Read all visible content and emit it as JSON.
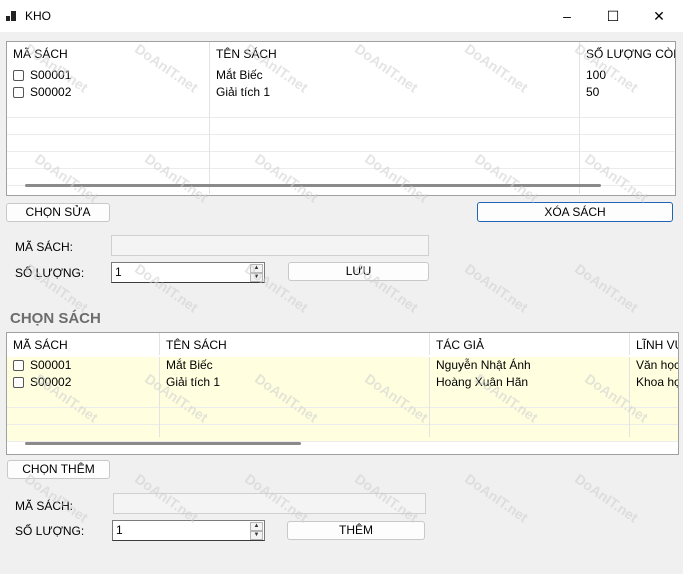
{
  "window": {
    "title": "KHO",
    "minimize_icon": "–",
    "maximize_icon": "☐",
    "close_icon": "✕"
  },
  "grid1": {
    "headers": [
      "MÃ SÁCH",
      "TÊN SÁCH",
      "SỐ LƯỢNG CÒN LẠI"
    ],
    "rows": [
      {
        "ma": "S00001",
        "ten": "Mắt Biếc",
        "soluong": "100"
      },
      {
        "ma": "S00002",
        "ten": "Giải tích 1",
        "soluong": "50"
      }
    ]
  },
  "actions1": {
    "chon_sua": "CHỌN SỬA",
    "xoa_sach": "XÓA SÁCH"
  },
  "form1": {
    "ma_sach_label": "MÃ SÁCH:",
    "so_luong_label": "SỐ LƯỢNG:",
    "so_luong_value": "1",
    "luu": "LƯU"
  },
  "section2": {
    "title": "CHỌN SÁCH"
  },
  "grid2": {
    "headers": [
      "MÃ SÁCH",
      "TÊN SÁCH",
      "TÁC GIẢ",
      "LĨNH VỰC"
    ],
    "rows": [
      {
        "ma": "S00001",
        "ten": "Mắt Biếc",
        "tacgia": "Nguyễn Nhật Ánh",
        "linhvuc": "Văn học"
      },
      {
        "ma": "S00002",
        "ten": "Giải tích 1",
        "tacgia": "Hoàng Xuân Hãn",
        "linhvuc": "Khoa học"
      }
    ]
  },
  "actions2": {
    "chon_them": "CHỌN THÊM"
  },
  "form2": {
    "ma_sach_label": "MÃ SÁCH:",
    "so_luong_label": "SỐ LƯỢNG:",
    "so_luong_value": "1",
    "them": "THÊM"
  },
  "watermark": "DoAnIT.net",
  "colors": {
    "grid2_row_bg": "#ffffe0",
    "accent_border": "#1f64b5"
  }
}
